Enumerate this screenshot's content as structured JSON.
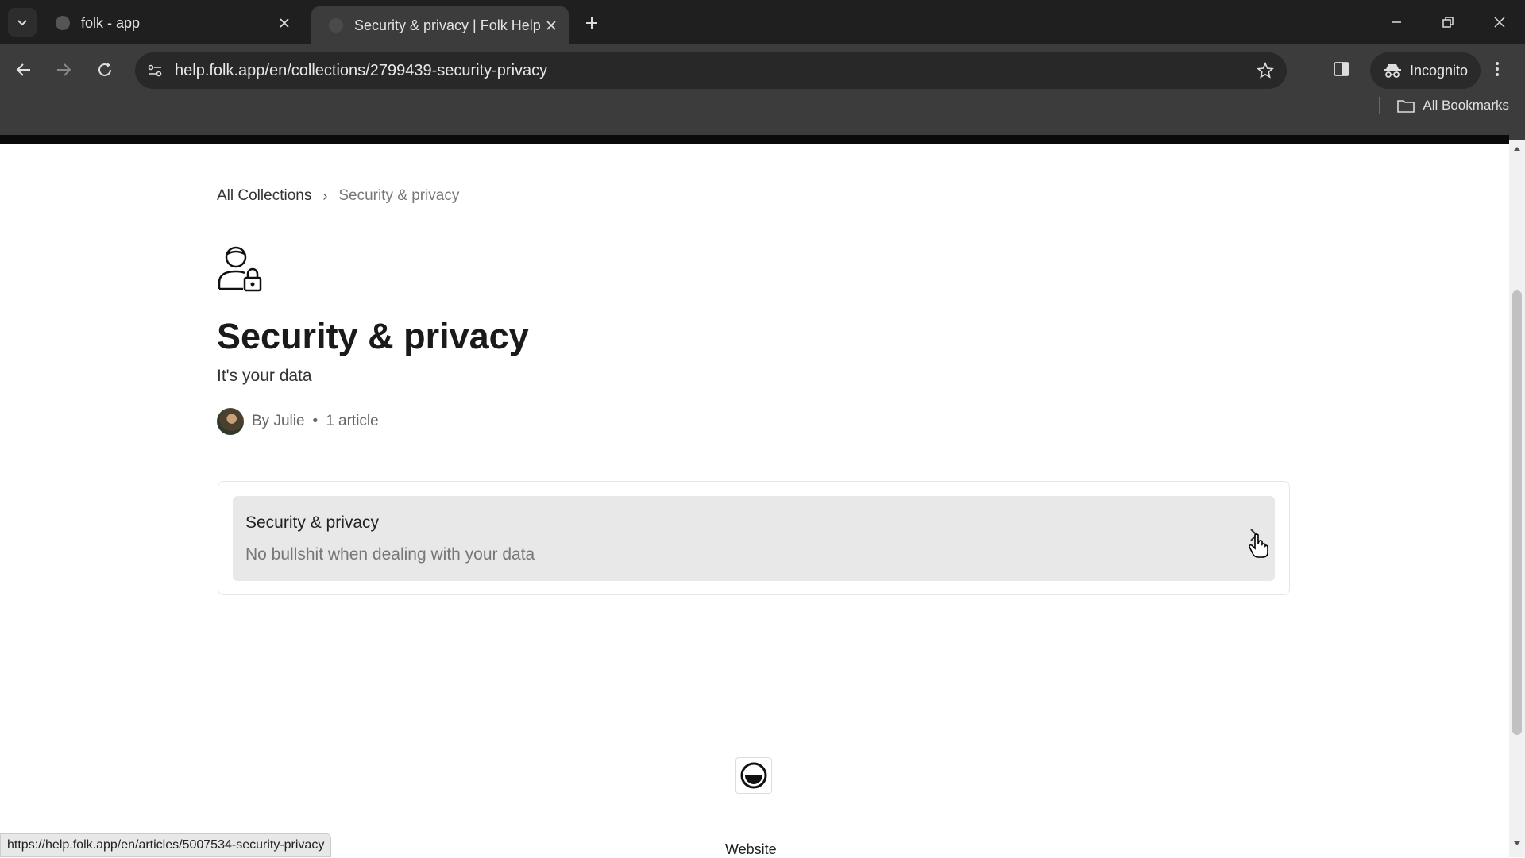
{
  "browser": {
    "tabs": [
      {
        "title": "folk - app",
        "active": false
      },
      {
        "title": "Security & privacy | Folk Help &",
        "active": true
      }
    ],
    "url": "help.folk.app/en/collections/2799439-security-privacy",
    "incognito_label": "Incognito",
    "bookmarks_label": "All Bookmarks",
    "status_url": "https://help.folk.app/en/articles/5007534-security-privacy"
  },
  "breadcrumb": {
    "root": "All Collections",
    "separator": "›",
    "current": "Security & privacy"
  },
  "collection": {
    "icon": "user-lock-icon",
    "title": "Security & privacy",
    "subtitle": "It's your data",
    "author": "By Julie",
    "bullet": "•",
    "article_count": "1 article"
  },
  "articles": [
    {
      "title": "Security & privacy",
      "description": "No bullshit when dealing with your data"
    }
  ],
  "footer": {
    "link": "Website"
  },
  "colors": {
    "chrome_dark": "#1f1f1f",
    "toolbar": "#3c3c3c",
    "card_hover": "#e8e8e8"
  }
}
